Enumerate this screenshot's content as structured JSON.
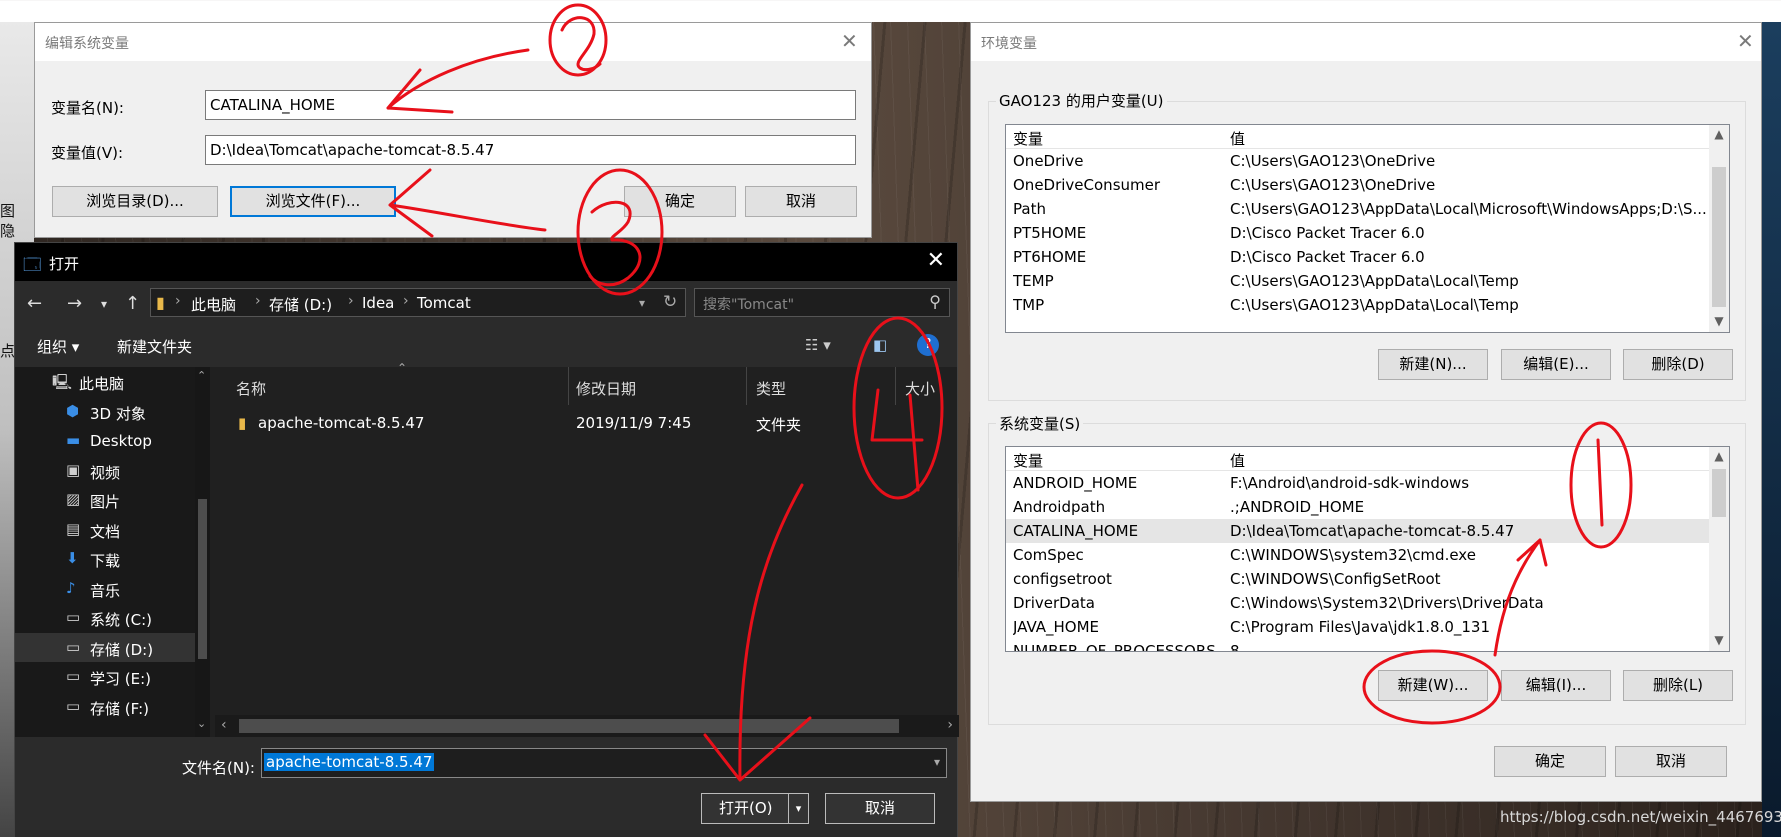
{
  "background": {
    "left_text_1": "图",
    "left_text_2": "隐",
    "left_text_3": "点",
    "watermark": "https://blog.csdn.net/weixin_44676935"
  },
  "edit_dialog": {
    "title": "编辑系统变量",
    "name_label": "变量名(N):",
    "name_value": "CATALINA_HOME",
    "value_label": "变量值(V):",
    "value_value": "D:\\Idea\\Tomcat\\apache-tomcat-8.5.47",
    "browse_dir": "浏览目录(D)...",
    "browse_file": "浏览文件(F)...",
    "ok": "确定",
    "cancel": "取消"
  },
  "env_dialog": {
    "title": "环境变量",
    "user_group": "GAO123 的用户变量(U)",
    "col_var": "变量",
    "col_val": "值",
    "user_vars": [
      {
        "name": "OneDrive",
        "value": "C:\\Users\\GAO123\\OneDrive"
      },
      {
        "name": "OneDriveConsumer",
        "value": "C:\\Users\\GAO123\\OneDrive"
      },
      {
        "name": "Path",
        "value": "C:\\Users\\GAO123\\AppData\\Local\\Microsoft\\WindowsApps;D:\\S..."
      },
      {
        "name": "PT5HOME",
        "value": "D:\\Cisco Packet Tracer 6.0"
      },
      {
        "name": "PT6HOME",
        "value": "D:\\Cisco Packet Tracer 6.0"
      },
      {
        "name": "TEMP",
        "value": "C:\\Users\\GAO123\\AppData\\Local\\Temp"
      },
      {
        "name": "TMP",
        "value": "C:\\Users\\GAO123\\AppData\\Local\\Temp"
      }
    ],
    "user_new": "新建(N)...",
    "user_edit": "编辑(E)...",
    "user_delete": "删除(D)",
    "sys_group": "系统变量(S)",
    "sys_vars": [
      {
        "name": "ANDROID_HOME",
        "value": "F:\\Android\\android-sdk-windows"
      },
      {
        "name": "Androidpath",
        "value": ".;ANDROID_HOME"
      },
      {
        "name": "CATALINA_HOME",
        "value": "D:\\Idea\\Tomcat\\apache-tomcat-8.5.47"
      },
      {
        "name": "ComSpec",
        "value": "C:\\WINDOWS\\system32\\cmd.exe"
      },
      {
        "name": "configsetroot",
        "value": "C:\\WINDOWS\\ConfigSetRoot"
      },
      {
        "name": "DriverData",
        "value": "C:\\Windows\\System32\\Drivers\\DriverData"
      },
      {
        "name": "JAVA_HOME",
        "value": "C:\\Program Files\\Java\\jdk1.8.0_131"
      },
      {
        "name": "NUMBER_OF_PROCESSORS",
        "value": "8"
      }
    ],
    "sys_new": "新建(W)...",
    "sys_edit": "编辑(I)...",
    "sys_delete": "删除(L)",
    "ok": "确定",
    "cancel": "取消"
  },
  "open_dialog": {
    "title": "打开",
    "breadcrumb": [
      "此电脑",
      "存储 (D:)",
      "Idea",
      "Tomcat"
    ],
    "search_placeholder": "搜索\"Tomcat\"",
    "organize": "组织 ▾",
    "new_folder": "新建文件夹",
    "nav_items": [
      {
        "label": "此电脑",
        "icon": "computer-icon"
      },
      {
        "label": "3D 对象",
        "icon": "3d-objects-icon"
      },
      {
        "label": "Desktop",
        "icon": "desktop-icon"
      },
      {
        "label": "视频",
        "icon": "video-icon"
      },
      {
        "label": "图片",
        "icon": "pictures-icon"
      },
      {
        "label": "文档",
        "icon": "documents-icon"
      },
      {
        "label": "下载",
        "icon": "download-icon"
      },
      {
        "label": "音乐",
        "icon": "music-icon"
      },
      {
        "label": "系统 (C:)",
        "icon": "drive-icon"
      },
      {
        "label": "存储 (D:)",
        "icon": "drive-icon"
      },
      {
        "label": "学习 (E:)",
        "icon": "drive-icon"
      },
      {
        "label": "存储 (F:)",
        "icon": "drive-icon"
      }
    ],
    "col_name": "名称",
    "col_date": "修改日期",
    "col_type": "类型",
    "col_size": "大小",
    "files": [
      {
        "name": "apache-tomcat-8.5.47",
        "date": "2019/11/9 7:45",
        "type": "文件夹"
      }
    ],
    "filename_label": "文件名(N):",
    "filename_value": "apache-tomcat-8.5.47",
    "open_button": "打开(O)",
    "cancel_button": "取消"
  },
  "annotations": [
    "1",
    "2",
    "3",
    "4"
  ],
  "colors": {
    "accent": "#0078d7",
    "annotation_red": "#e8101a",
    "dark_bg": "#202020"
  }
}
